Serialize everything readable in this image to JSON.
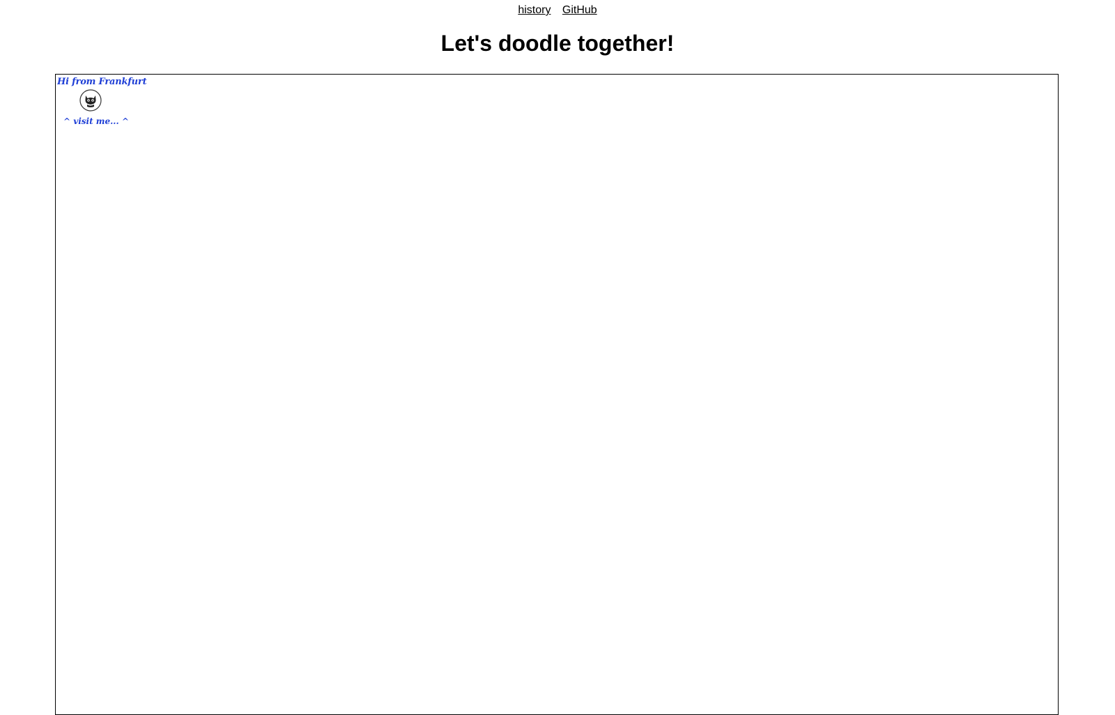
{
  "nav": {
    "history_label": "history",
    "github_label": "GitHub"
  },
  "header": {
    "title": "Let's doodle together!"
  },
  "canvas": {
    "greeting": "Hi from Frankfurt",
    "visit_text": "^ visit me... ^",
    "avatar_icon": "github-cat-icon",
    "text_color": "#1f3fd6",
    "border_color": "#000000"
  }
}
